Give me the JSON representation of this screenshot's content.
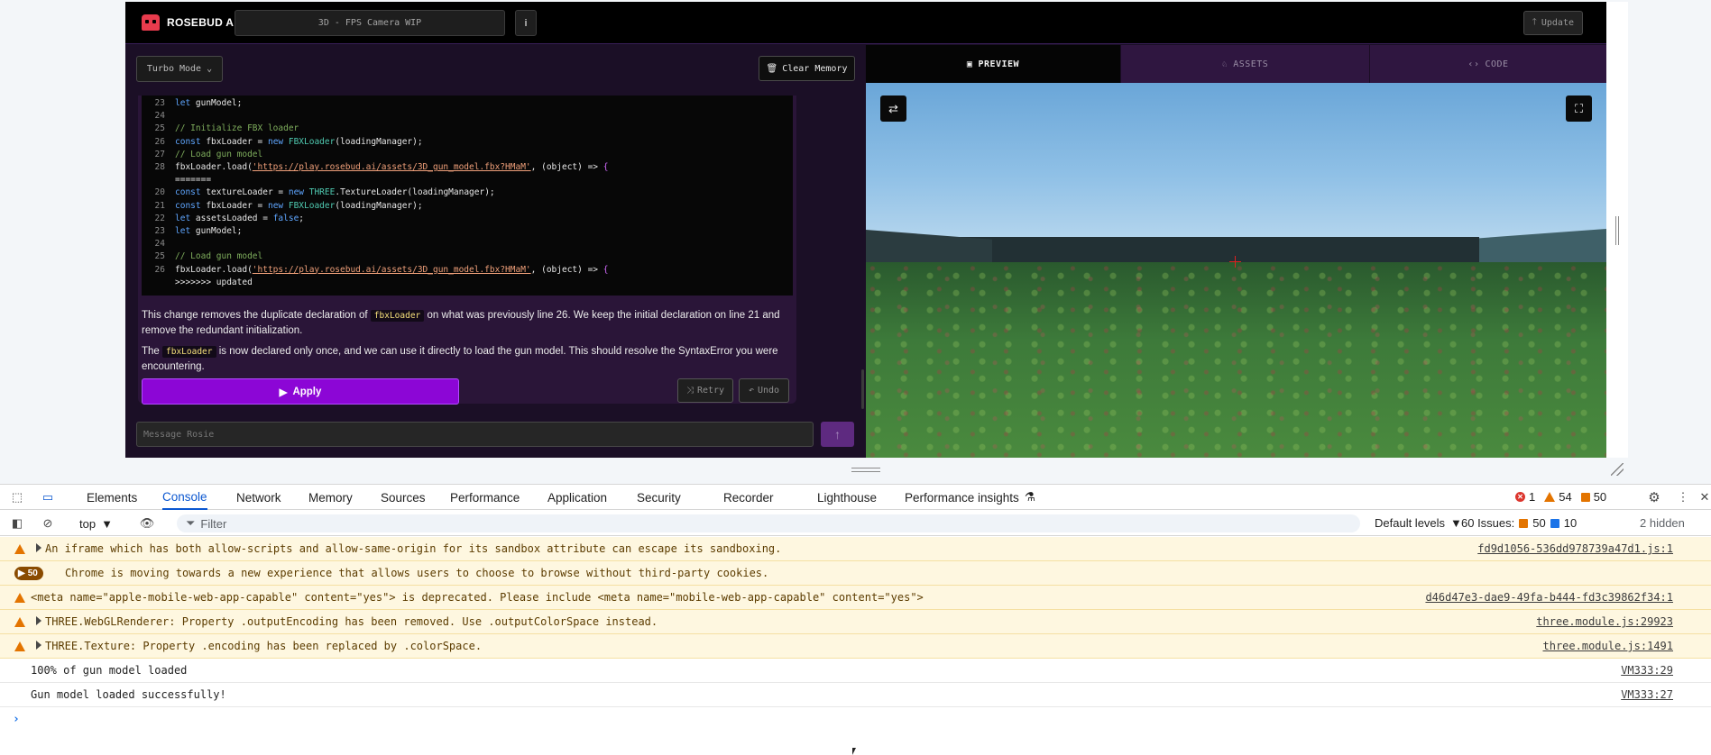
{
  "app": {
    "brand": "ROSEBUD AI",
    "project_title": "3D - FPS Camera WIP",
    "info_label": "i",
    "update_label": "Update"
  },
  "chat": {
    "mode_label": "Turbo Mode",
    "clear_memory_label": "Clear Memory",
    "code_lines": [
      {
        "n": "23",
        "parts": [
          {
            "t": "let ",
            "c": "kw"
          },
          {
            "t": "gunModel;",
            "c": ""
          }
        ]
      },
      {
        "n": "24",
        "parts": []
      },
      {
        "n": "25",
        "parts": [
          {
            "t": "// Initialize FBX loader",
            "c": "cm"
          }
        ]
      },
      {
        "n": "26",
        "parts": [
          {
            "t": "const ",
            "c": "kw"
          },
          {
            "t": "fbxLoader = ",
            "c": ""
          },
          {
            "t": "new ",
            "c": "kw"
          },
          {
            "t": "FBXLoader",
            "c": "cls"
          },
          {
            "t": "(loadingManager);",
            "c": ""
          }
        ]
      },
      {
        "n": "27",
        "parts": [
          {
            "t": "// Load gun model",
            "c": "cm"
          }
        ]
      },
      {
        "n": "28",
        "parts": [
          {
            "t": "fbxLoader.load(",
            "c": ""
          },
          {
            "t": "'https://play.rosebud.ai/assets/3D_gun_model.fbx?HMaM'",
            "c": "str"
          },
          {
            "t": ", (object) => ",
            "c": ""
          },
          {
            "t": "{",
            "c": "br"
          }
        ]
      },
      {
        "n": "",
        "parts": [
          {
            "t": "=======",
            "c": ""
          }
        ]
      },
      {
        "n": "20",
        "parts": [
          {
            "t": "const ",
            "c": "kw"
          },
          {
            "t": "textureLoader = ",
            "c": ""
          },
          {
            "t": "new ",
            "c": "kw"
          },
          {
            "t": "THREE",
            "c": "cls"
          },
          {
            "t": ".TextureLoader(loadingManager);",
            "c": ""
          }
        ]
      },
      {
        "n": "21",
        "parts": [
          {
            "t": "const ",
            "c": "kw"
          },
          {
            "t": "fbxLoader = ",
            "c": ""
          },
          {
            "t": "new ",
            "c": "kw"
          },
          {
            "t": "FBXLoader",
            "c": "cls"
          },
          {
            "t": "(loadingManager);",
            "c": ""
          }
        ]
      },
      {
        "n": "22",
        "parts": [
          {
            "t": "let ",
            "c": "kw"
          },
          {
            "t": "assetsLoaded = ",
            "c": ""
          },
          {
            "t": "false",
            "c": "bool"
          },
          {
            "t": ";",
            "c": ""
          }
        ]
      },
      {
        "n": "23",
        "parts": [
          {
            "t": "let ",
            "c": "kw"
          },
          {
            "t": "gunModel;",
            "c": ""
          }
        ]
      },
      {
        "n": "24",
        "parts": []
      },
      {
        "n": "25",
        "parts": [
          {
            "t": "// Load gun model",
            "c": "cm"
          }
        ]
      },
      {
        "n": "26",
        "parts": [
          {
            "t": "fbxLoader.load(",
            "c": ""
          },
          {
            "t": "'https://play.rosebud.ai/assets/3D_gun_model.fbx?HMaM'",
            "c": "str"
          },
          {
            "t": ", (object) => ",
            "c": ""
          },
          {
            "t": "{",
            "c": "br"
          }
        ]
      },
      {
        "n": "",
        "parts": [
          {
            "t": ">>>>>>> updated",
            "c": ""
          }
        ]
      }
    ],
    "paragraph1": {
      "before": "This change removes the duplicate declaration of ",
      "code": "fbxLoader",
      "after": " on what was previously line 26. We keep the initial declaration on line 21 and remove the redundant initialization."
    },
    "paragraph2": {
      "before": "The ",
      "code": "fbxLoader",
      "after": " is now declared only once, and we can use it directly to load the gun model. This should resolve the SyntaxError you were encountering."
    },
    "apply_label": "Apply",
    "retry_label": "Retry",
    "undo_label": "Undo",
    "message_placeholder": "Message Rosie"
  },
  "preview": {
    "tabs": [
      {
        "label": "PREVIEW",
        "icon": "image-icon",
        "active": true
      },
      {
        "label": "ASSETS",
        "icon": "assets-icon",
        "active": false
      },
      {
        "label": "CODE",
        "icon": "code-icon",
        "active": false
      }
    ]
  },
  "devtools": {
    "tabs": [
      "Elements",
      "Console",
      "Network",
      "Memory",
      "Sources",
      "Performance",
      "Application",
      "Security",
      "Recorder",
      "Lighthouse",
      "Performance insights"
    ],
    "active_tab": "Console",
    "counts": {
      "errors": "1",
      "warnings": "54",
      "issues": "50"
    },
    "context": "top",
    "filter_placeholder": "Filter",
    "levels_label": "Default levels",
    "issues_label": "60 Issues:",
    "issues_warn": "50",
    "issues_info": "10",
    "hidden_label": "2 hidden",
    "rows": [
      {
        "type": "warn",
        "expandable": true,
        "message": "An iframe which has both allow-scripts and allow-same-origin for its sandbox attribute can escape its sandboxing.",
        "source": "fd9d1056-536dd978739a47d1.js:1"
      },
      {
        "type": "group",
        "badge": "50",
        "message": "Chrome is moving towards a new experience that allows users to choose to browse without third-party cookies.",
        "source": ""
      },
      {
        "type": "warn",
        "expandable": false,
        "message": "<meta name=\"apple-mobile-web-app-capable\" content=\"yes\"> is deprecated. Please include <meta name=\"mobile-web-app-capable\" content=\"yes\">",
        "source": "d46d47e3-dae9-49fa-b444-fd3c39862f34:1"
      },
      {
        "type": "warn",
        "expandable": true,
        "message": "THREE.WebGLRenderer: Property .outputEncoding has been removed. Use .outputColorSpace instead.",
        "source": "three.module.js:29923"
      },
      {
        "type": "warn",
        "expandable": true,
        "message": "THREE.Texture: Property .encoding has been replaced by .colorSpace.",
        "source": "three.module.js:1491"
      },
      {
        "type": "log",
        "expandable": false,
        "message": "100% of gun model loaded",
        "source": "VM333:29"
      },
      {
        "type": "log",
        "expandable": false,
        "message": "Gun model loaded successfully!",
        "source": "VM333:27"
      }
    ]
  },
  "colors": {
    "accent": "#8c06d6",
    "devtools_blue": "#0b57d0",
    "warning": "#e37400",
    "error": "#dc362e"
  }
}
